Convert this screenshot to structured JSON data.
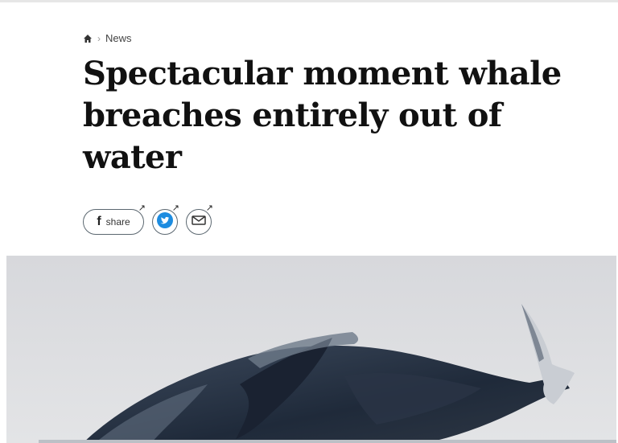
{
  "breadcrumb": {
    "home_icon": "home-icon",
    "separator": "›",
    "section": "News"
  },
  "article": {
    "headline": "Spectacular moment whale breaches entirely out of water"
  },
  "share": {
    "facebook_icon": "facebook-icon",
    "facebook_label": "share",
    "twitter_icon": "twitter-icon",
    "email_icon": "email-icon"
  },
  "colors": {
    "headline": "#111111",
    "button_border": "#5b6770",
    "twitter_blue": "#1d8ce0",
    "sky": "#dcdde0"
  }
}
